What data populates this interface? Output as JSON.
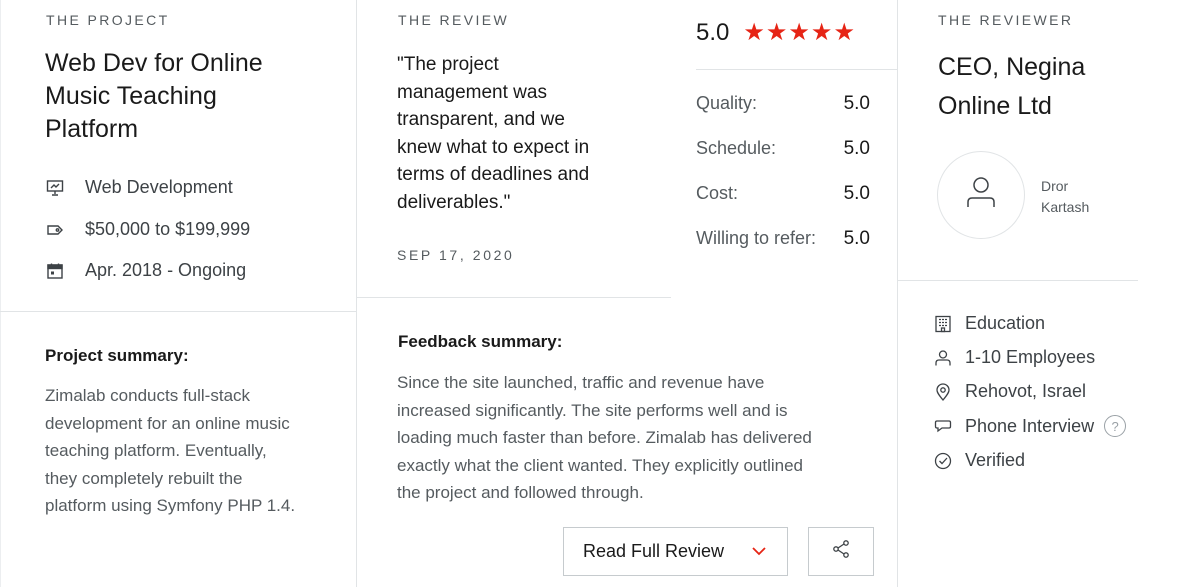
{
  "project": {
    "eyebrow": "THE PROJECT",
    "title_lines": [
      "Web Dev for Online",
      "Music Teaching",
      "Platform"
    ],
    "service": "Web Development",
    "budget": "$50,000 to $199,999",
    "dates": "Apr. 2018 - Ongoing",
    "summary_heading": "Project summary:",
    "summary_lines": [
      "Zimalab conducts full-stack",
      "development for an online music",
      "teaching platform. Eventually,",
      "they completely rebuilt the",
      "platform using Symfony PHP 1.4."
    ]
  },
  "review": {
    "eyebrow": "THE REVIEW",
    "quote_lines": [
      "\"The project",
      "management was",
      "transparent, and we",
      "knew what to expect in",
      "terms of deadlines and",
      "deliverables.\""
    ],
    "date": "SEP 17, 2020",
    "overall": "5.0",
    "stars": "★★★★★",
    "scores": [
      {
        "label": "Quality:",
        "value": "5.0"
      },
      {
        "label": "Schedule:",
        "value": "5.0"
      },
      {
        "label": "Cost:",
        "value": "5.0"
      },
      {
        "label": "Willing to refer:",
        "value": "5.0"
      }
    ],
    "feedback_heading": "Feedback summary:",
    "feedback_lines": [
      "Since the site launched, traffic and revenue have",
      "increased significantly. The site performs well and is",
      "loading much faster than before. Zimalab has delivered",
      "exactly what the client wanted. They explicitly outlined",
      "the project and followed through."
    ],
    "read_full_label": "Read Full Review"
  },
  "reviewer": {
    "eyebrow": "THE REVIEWER",
    "title_lines": [
      "CEO, Negina",
      "Online Ltd"
    ],
    "name_lines": [
      "Dror",
      "Kartash"
    ],
    "industry": "Education",
    "size": "1-10 Employees",
    "location": "Rehovot, Israel",
    "review_type": "Phone Interview",
    "help_glyph": "?",
    "verified": "Verified"
  },
  "colors": {
    "star": "#e62415",
    "divider": "#e1e4e6",
    "muted_text": "#555b5f"
  }
}
